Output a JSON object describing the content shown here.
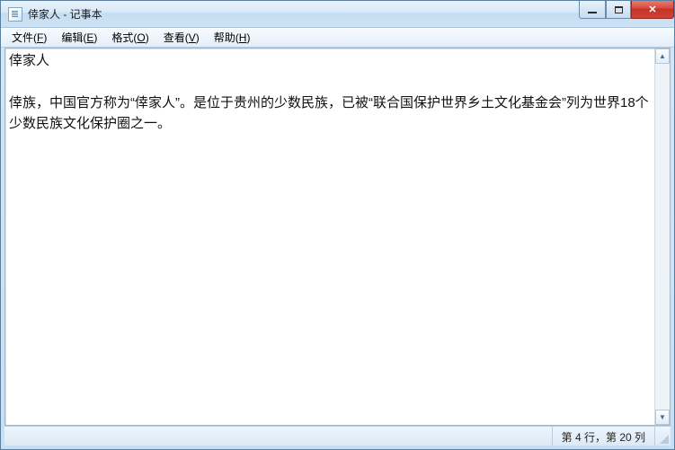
{
  "window": {
    "title": "倖家人 - 记事本"
  },
  "menu": {
    "file": {
      "label": "文件",
      "mnemonic": "F"
    },
    "edit": {
      "label": "编辑",
      "mnemonic": "E"
    },
    "format": {
      "label": "格式",
      "mnemonic": "O"
    },
    "view": {
      "label": "查看",
      "mnemonic": "V"
    },
    "help": {
      "label": "帮助",
      "mnemonic": "H"
    }
  },
  "document": {
    "content": "倖家人\n\n倖族，中国官方称为“倖家人”。是位于贵州的少数民族，已被“联合国保护世界乡土文化基金会”列为世界18个少数民族文化保护圈之一。"
  },
  "status": {
    "position": "第 4 行，第 20 列"
  }
}
